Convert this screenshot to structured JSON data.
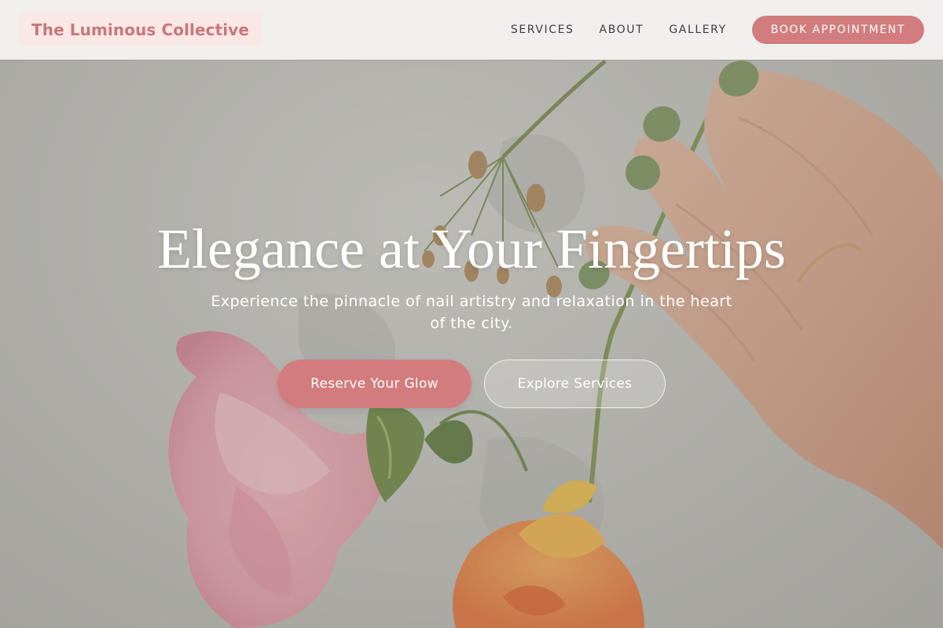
{
  "header": {
    "logo_text": "The Luminous Collective",
    "nav": [
      {
        "label": "SERVICES"
      },
      {
        "label": "ABOUT"
      },
      {
        "label": "GALLERY"
      }
    ],
    "book_button": "BOOK APPOINTMENT"
  },
  "hero": {
    "title": "Elegance at Your Fingertips",
    "subtitle": "Experience the pinnacle of nail artistry and relaxation in the heart of the city.",
    "primary_cta": "Reserve Your Glow",
    "secondary_cta": "Explore Services",
    "background_image": "hand-with-green-nails-and-flowers"
  },
  "colors": {
    "accent": "#d27c7d",
    "logo_text": "#c9777a",
    "logo_bg": "#fae8e6",
    "nav_text": "#3a3c4a",
    "header_bg": "#f2f1f0"
  }
}
